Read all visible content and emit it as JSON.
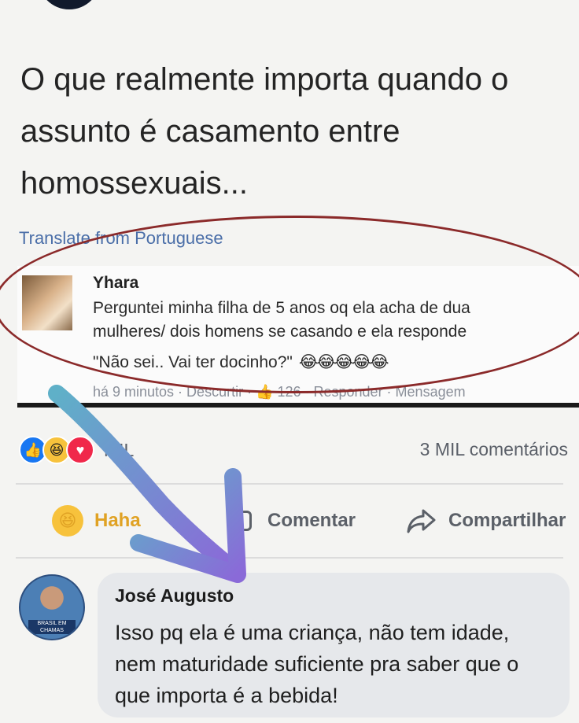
{
  "post": {
    "text_line1": "O que realmente importa quando o",
    "text_line2": "assunto é casamento entre",
    "text_line3": "homossexuais...",
    "translate_link": "Translate from Portuguese"
  },
  "embedded_comment": {
    "name": "Yhara",
    "line1": "Perguntei minha filha de 5 anos oq ela acha de dua",
    "line2": "mulheres/ dois homens se casando e ela responde",
    "line3": "\"Não sei.. Vai ter docinho?\"",
    "emojis": "😂😂😂😂😂",
    "meta": "há 9 minutos · Descurtir · 👍 126 · Responder · Mensagem"
  },
  "stats": {
    "reaction_count": "MIL",
    "comments_count": "3 MIL comentários"
  },
  "actions": {
    "haha_label": "Haha",
    "comment_label": "Comentar",
    "share_label": "Compartilhar"
  },
  "comment": {
    "author": "José Augusto",
    "text": "Isso pq ela é uma criança, não tem idade, nem maturidade suficiente pra saber que o que importa é a bebida!",
    "avatar_badge": "BRASIL EM CHAMAS"
  },
  "colors": {
    "annotation_oval": "#8b2a2a",
    "annotation_arrow": "#7a6fd0",
    "link": "#4a6ea8",
    "haha": "#e0a224"
  },
  "icons": [
    "like-icon",
    "haha-icon",
    "love-icon",
    "comment-icon",
    "share-icon"
  ]
}
